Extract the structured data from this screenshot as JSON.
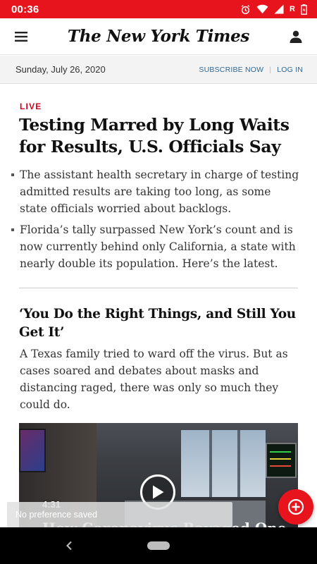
{
  "status_bar": {
    "time": "00:36",
    "carrier_badge": "R",
    "icons": [
      "alarm-icon",
      "wifi-icon",
      "signal-icon",
      "battery-icon"
    ],
    "background_color": "#e8141d"
  },
  "header": {
    "logo": "The New York Times",
    "menu_icon": "menu-icon",
    "account_icon": "account-icon"
  },
  "subbar": {
    "date": "Sunday, July 26, 2020",
    "subscribe_label": "SUBSCRIBE NOW",
    "separator": "|",
    "login_label": "LOG IN"
  },
  "lead_story": {
    "live_label": "LIVE",
    "headline": "Testing Marred by Long Waits for Results, U.S. Officials Say",
    "bullets": [
      "The assistant health secretary in charge of testing admitted results are taking too long, as some state officials worried about backlogs.",
      "Florida’s tally surpassed New York’s count and is now currently behind only California, a state with nearly double its population. Here’s the latest."
    ]
  },
  "second_story": {
    "headline": "‘You Do the Right Things, and Still You Get It’",
    "summary": "A Texas family tried to ward off the virus. But as cases soared and debates about masks and distancing raged, there was only so much they could do."
  },
  "video": {
    "duration": "4:31",
    "caption": "How Coronavirus Ravaged One",
    "play_icon": "play-icon"
  },
  "toast": {
    "text": "No preference saved"
  },
  "fab": {
    "icon": "add-icon",
    "color": "#e8141d"
  },
  "nav": {
    "back_icon": "back-icon",
    "home_icon": "home-pill-icon"
  }
}
